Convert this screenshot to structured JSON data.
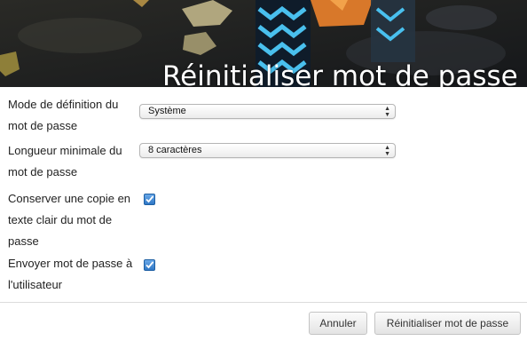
{
  "header": {
    "title": "Réinitialiser mot de passe"
  },
  "form": {
    "mode_label": "Mode de définition du mot de passe",
    "mode_value": "Système",
    "length_label": "Longueur minimale du mot de passe",
    "length_value": "8 caractères",
    "keep_copy_label": "Conserver une copie en texte clair du mot de passe",
    "keep_copy_checked": true,
    "send_label": "Envoyer mot de passe à l'utilisateur",
    "send_checked": true
  },
  "footer": {
    "cancel_label": "Annuler",
    "submit_label": "Réinitialiser mot de passe"
  },
  "colors": {
    "checkbox_blue": "#2f78c6",
    "banner_dark": "#1c1d1f"
  }
}
